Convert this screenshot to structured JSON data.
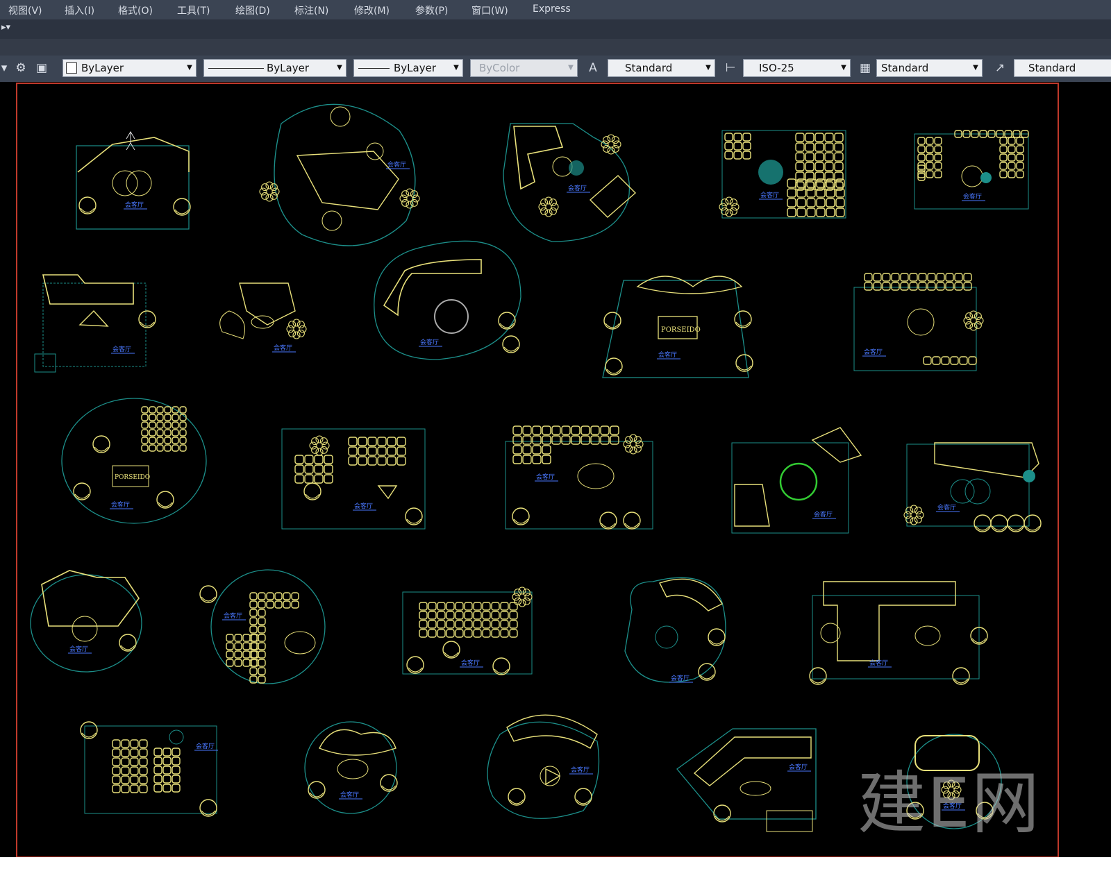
{
  "menubar": {
    "items": [
      "视图(V)",
      "插入(I)",
      "格式(O)",
      "工具(T)",
      "绘图(D)",
      "标注(N)",
      "修改(M)",
      "参数(P)",
      "窗口(W)",
      "Express"
    ]
  },
  "toolbar": {
    "layer_color": "ByLayer",
    "linetype": "ByLayer",
    "lineweight": "ByLayer",
    "plot_style": "ByColor",
    "text_style": "Standard",
    "dim_style": "ISO-25",
    "table_style": "Standard",
    "multileader_style": "Standard"
  },
  "drawing": {
    "block_label": "会客厅",
    "logo_text": "PORSEIDO",
    "watermark": "建E网",
    "colors": {
      "background": "#000000",
      "furniture": "#e8e07a",
      "outline": "#1c8f8a",
      "border": "#c0392b",
      "label": "#4a78ff",
      "plant": "#33cc33"
    }
  }
}
